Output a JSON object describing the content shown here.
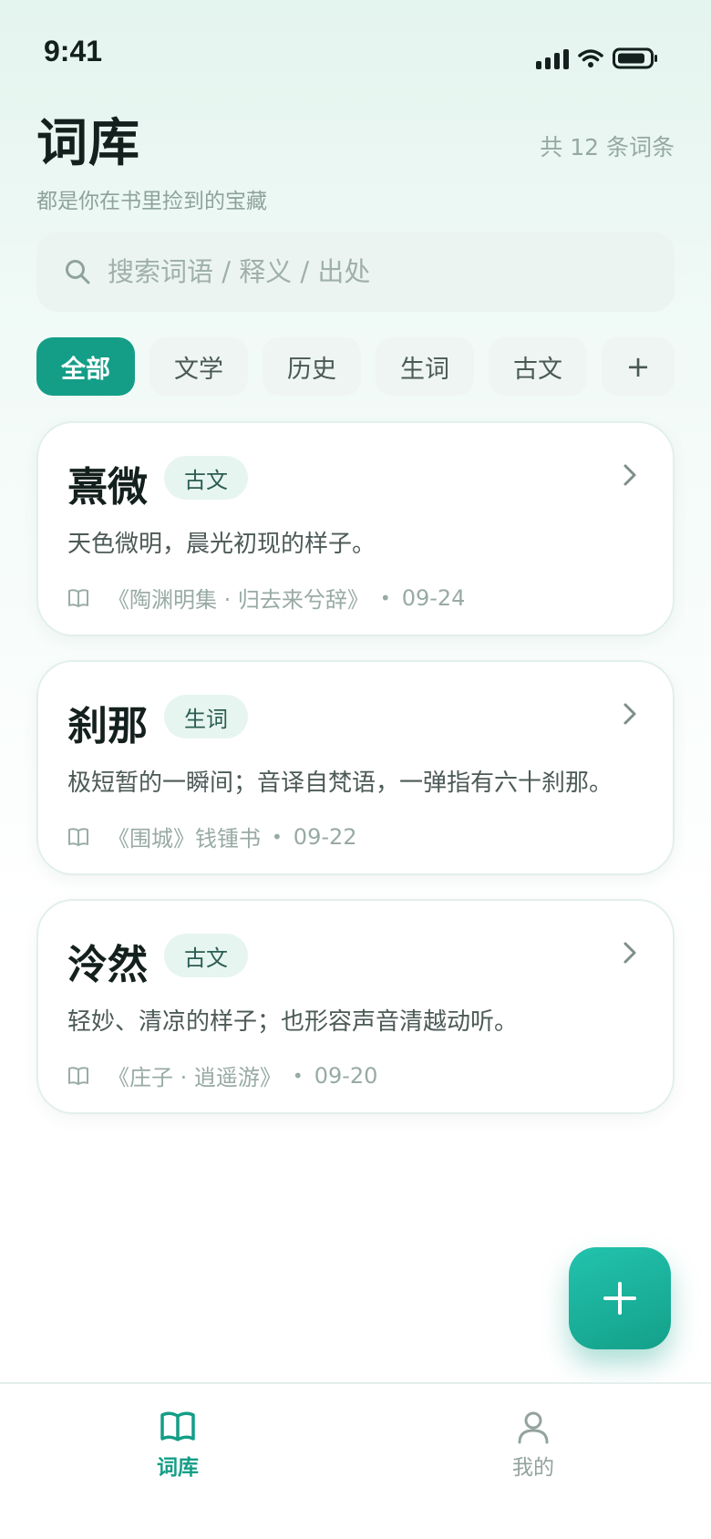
{
  "status": {
    "time": "9:41"
  },
  "header": {
    "title": "词库",
    "subtitle": "都是你在书里捡到的宝藏",
    "count": "共 12 条词条"
  },
  "search": {
    "placeholder": "搜索词语 / 释义 / 出处"
  },
  "filters": [
    "全部",
    "文学",
    "历史",
    "生词",
    "古文"
  ],
  "filters_active": "全部",
  "filters_add": "+",
  "entries": [
    {
      "term": "熹微",
      "tag": "古文",
      "definition": "天色微明，晨光初现的样子。",
      "source": "《陶渊明集 · 归去来兮辞》",
      "date": "09-24"
    },
    {
      "term": "刹那",
      "tag": "生词",
      "definition": "极短暂的一瞬间；音译自梵语，一弹指有六十刹那。",
      "source": "《围城》钱锺书",
      "date": "09-22"
    },
    {
      "term": "泠然",
      "tag": "古文",
      "definition": "轻妙、清凉的样子；也形容声音清越动听。",
      "source": "《庄子 · 逍遥游》",
      "date": "09-20"
    }
  ],
  "tabbar": {
    "items": [
      {
        "label": "词库",
        "icon": "book-icon",
        "active": true
      },
      {
        "label": "我的",
        "icon": "user-icon",
        "active": false
      }
    ]
  },
  "colors": {
    "accent": "#149e87",
    "text": "#14201d",
    "muted": "#98aaa4"
  }
}
